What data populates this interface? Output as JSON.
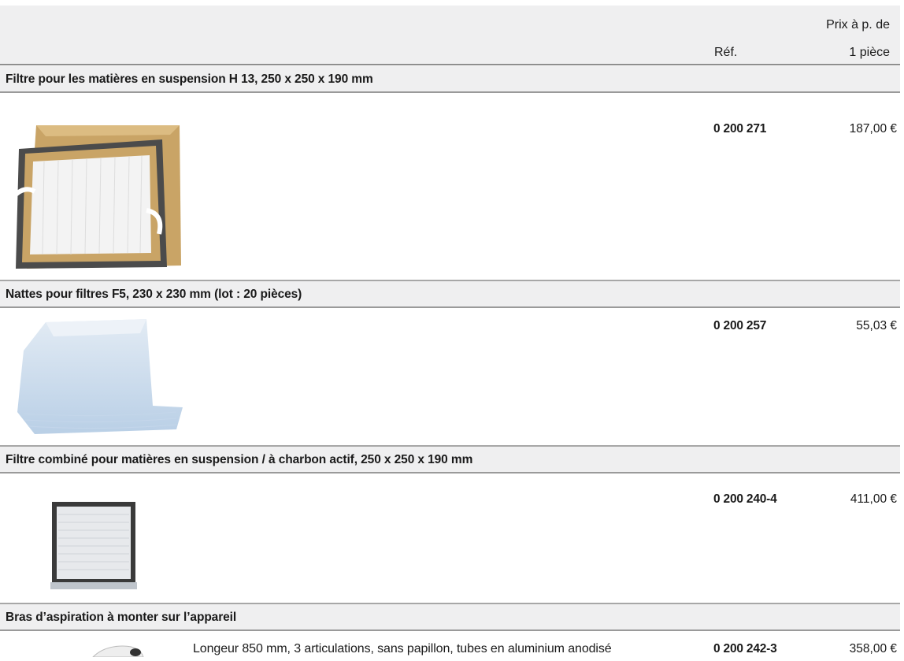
{
  "header": {
    "ref_label": "Réf.",
    "price_label_line1": "Prix à p. de",
    "price_label_line2": "1 pièce"
  },
  "products": [
    {
      "title": "Filtre pour les matières en suspension H 13, 250 x 250 x 190 mm",
      "ref": "0 200 271",
      "price": "187,00 €",
      "image": "hepa-filter-box-image"
    },
    {
      "title": "Nattes pour filtres F5, 230 x 230 mm (lot : 20 pièces)",
      "ref": "0 200 257",
      "price": "55,03 €",
      "image": "filter-mat-stack-image"
    },
    {
      "title": "Filtre combiné pour matières en suspension / à charbon actif, 250 x 250 x 190 mm",
      "ref": "0 200 240-4",
      "price": "411,00 €",
      "image": "combined-filter-image"
    },
    {
      "title": "Bras d’aspiration à monter sur l’appareil",
      "description": "Longeur 850 mm, 3 articulations, sans papillon, tubes en aluminium anodisé",
      "ref": "0 200 242-3",
      "price": "358,00 €",
      "image": "suction-arm-image"
    }
  ]
}
